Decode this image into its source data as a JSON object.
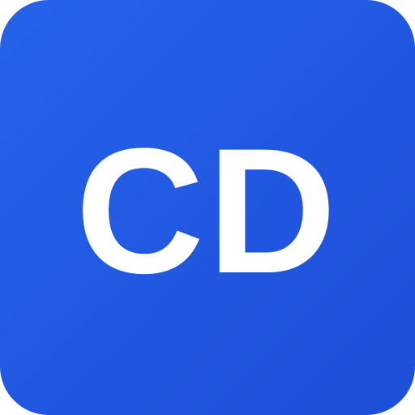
{
  "icon": {
    "monogram": "CD",
    "background_color_start": "#2563eb",
    "background_color_end": "#1d4ed8",
    "text_color": "#ffffff"
  }
}
